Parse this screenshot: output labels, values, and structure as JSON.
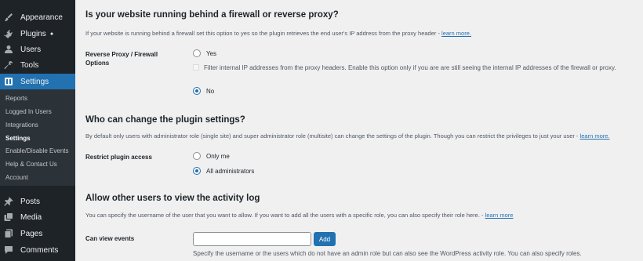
{
  "sidebar": {
    "menu": [
      {
        "label": "Appearance",
        "icon": "paintbrush-icon"
      },
      {
        "label": "Plugins",
        "icon": "plugin-icon",
        "badge": "●"
      },
      {
        "label": "Users",
        "icon": "user-icon"
      },
      {
        "label": "Tools",
        "icon": "wrench-icon"
      },
      {
        "label": "Settings",
        "icon": "settings-icon"
      }
    ],
    "submenu": [
      "Reports",
      "Logged In Users",
      "Integrations",
      "Settings",
      "Enable/Disable Events",
      "Help & Contact Us",
      "Account"
    ],
    "menu_bottom": [
      {
        "label": "Posts",
        "icon": "pin-icon"
      },
      {
        "label": "Media",
        "icon": "media-icon"
      },
      {
        "label": "Pages",
        "icon": "pages-icon"
      },
      {
        "label": "Comments",
        "icon": "comment-icon"
      }
    ]
  },
  "proxy": {
    "title": "Is your website running behind a firewall or reverse proxy?",
    "desc": "If your website is running behind a firewall set this option to yes so the plugin retrieves the end user's IP address from the proxy header -",
    "learn_more": "learn more.",
    "label": "Reverse Proxy / Firewall Options",
    "yes": "Yes",
    "filter_text": "Filter internal IP addresses from the proxy headers. Enable this option only if you are are still seeing the internal IP addresses of the firewall or proxy.",
    "no": "No"
  },
  "access": {
    "title": "Who can change the plugin settings?",
    "desc": "By default only users with administrator role (single site) and super administrator role (multisite) can change the settings of the plugin. Though you can restrict the privileges to just your user -",
    "learn_more": "learn more.",
    "label": "Restrict plugin access",
    "only_me": "Only me",
    "all_admins": "All administrators"
  },
  "viewers": {
    "title": "Allow other users to view the activity log",
    "desc": "You can specify the username of the user that you want to allow. If you want to add all the users with a specific role, you can also specify their role here. -",
    "learn_more": "learn more",
    "label": "Can view events",
    "input_value": "",
    "add_label": "Add",
    "help": "Specify the username or the users which do not have an admin role but can also see the WordPress activity role. You can also specify roles."
  },
  "colors": {
    "sidebar_bg": "#1d2327",
    "submenu_bg": "#2c3338",
    "accent": "#2271b1",
    "page_bg": "#f0f0f1"
  }
}
